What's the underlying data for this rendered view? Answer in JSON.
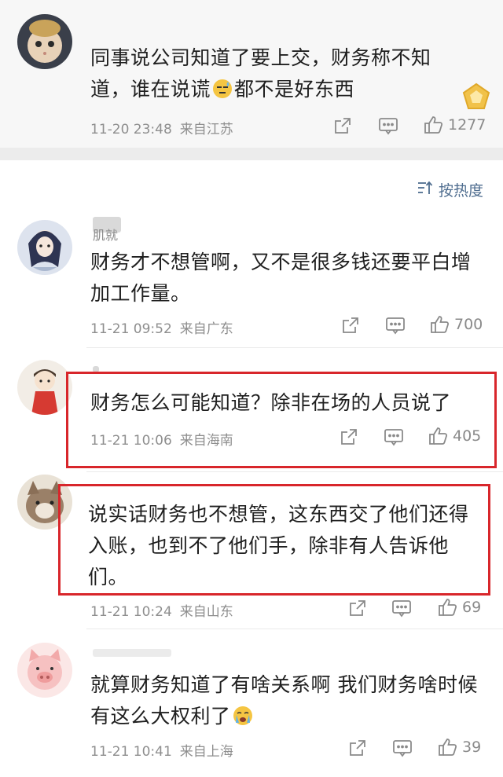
{
  "sort": {
    "label": "按热度"
  },
  "comments": [
    {
      "text_parts": [
        "同事说公司知道了要上交，财务称不知道，谁在说谎",
        "都不是好东西"
      ],
      "time": "11-20 23:48",
      "source": "来自江苏",
      "likes": "1277"
    },
    {
      "name": "肌就",
      "text": "财务才不想管啊，又不是很多钱还要平白增加工作量。",
      "time": "11-21 09:52",
      "source": "来自广东",
      "likes": "700"
    },
    {
      "text": "财务怎么可能知道？除非在场的人员说了",
      "time": "11-21 10:06",
      "source": "来自海南",
      "likes": "405"
    },
    {
      "text": "说实话财务也不想管，这东西交了他们还得入账，也到不了他们手，除非有人告诉他们。",
      "time": "11-21 10:24",
      "source": "来自山东",
      "likes": "69"
    },
    {
      "text_parts": [
        "就算财务知道了有啥关系啊 我们财务啥时候有这么大权利了"
      ],
      "time": "11-21 10:41",
      "source": "来自上海",
      "likes": "39"
    }
  ],
  "colors": {
    "highlight": "#d8262b",
    "sort_link": "#4f6d8f",
    "meta": "#8e8e8e"
  },
  "icons": [
    "share-icon",
    "comment-icon",
    "like-icon",
    "sort-icon",
    "sweat-emoji-icon",
    "crying-emoji-icon",
    "fan-badge-icon"
  ]
}
